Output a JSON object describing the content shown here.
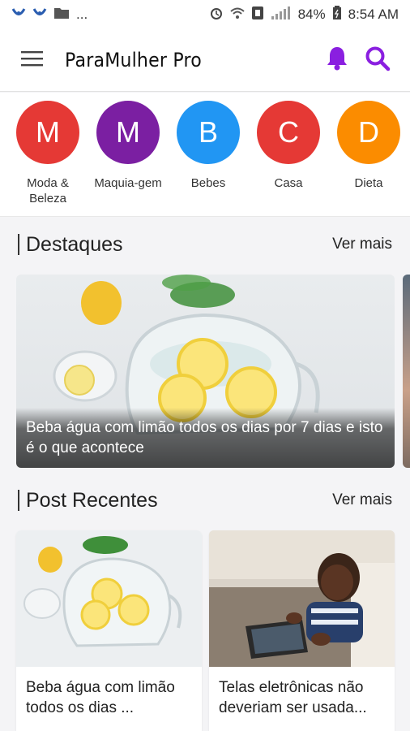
{
  "status_bar": {
    "battery": "84%",
    "time": "8:54 AM",
    "more": "..."
  },
  "app_bar": {
    "title": "ParaMulher Pro",
    "bell_color": "#8a1fe0",
    "search_color": "#8a1fe0"
  },
  "categories": [
    {
      "letter": "M",
      "label": "Moda & Beleza",
      "color": "#e53935"
    },
    {
      "letter": "M",
      "label": "Maquia-gem",
      "color": "#7b1fa2"
    },
    {
      "letter": "B",
      "label": "Bebes",
      "color": "#2196f3"
    },
    {
      "letter": "C",
      "label": "Casa",
      "color": "#e53935"
    },
    {
      "letter": "D",
      "label": "Dieta",
      "color": "#fb8c00"
    }
  ],
  "highlights": {
    "title": "Destaques",
    "see_more": "Ver mais",
    "featured_caption": "Beba água com limão todos os dias por 7 dias e isto é o que acontece"
  },
  "recent": {
    "title": "Post Recentes",
    "see_more": "Ver mais",
    "posts": [
      {
        "title": "Beba água com limão todos os dias ..."
      },
      {
        "title": "Telas eletrônicas não deveriam ser usada..."
      }
    ]
  }
}
